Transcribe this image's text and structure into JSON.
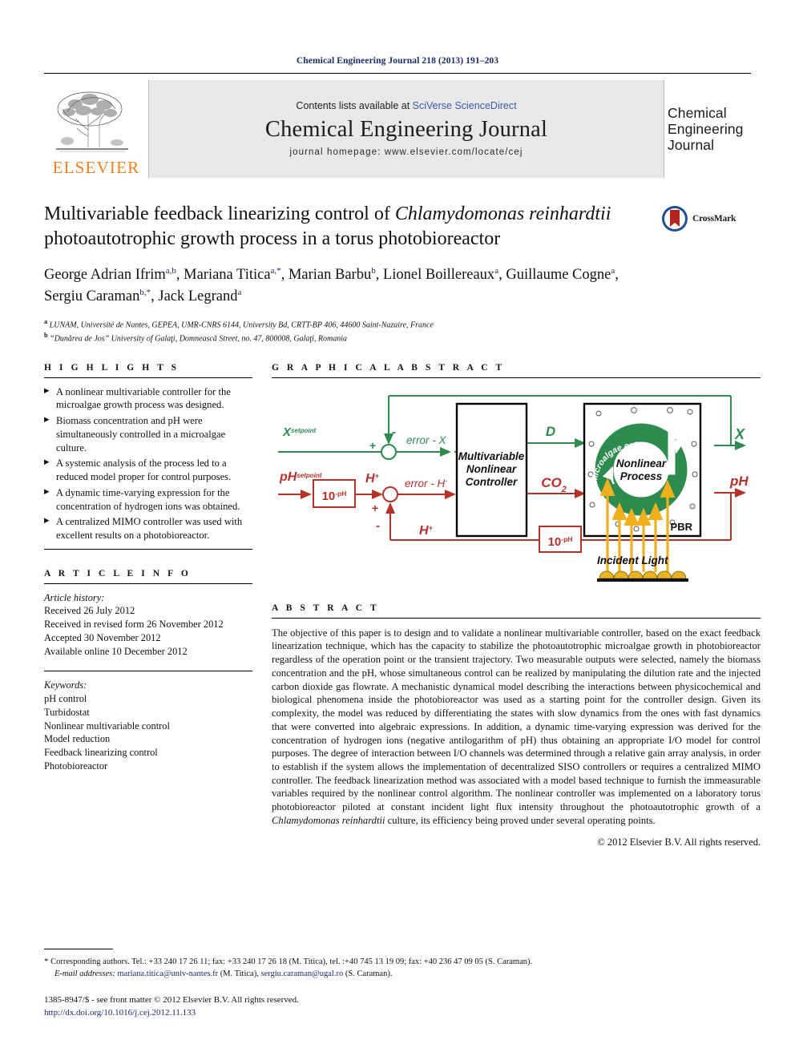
{
  "running_head": "Chemical Engineering Journal 218 (2013) 191–203",
  "masthead": {
    "contents_prefix": "Contents lists available at ",
    "contents_link": "SciVerse ScienceDirect",
    "journal_title": "Chemical Engineering Journal",
    "homepage": "journal homepage: www.elsevier.com/locate/cej",
    "publisher_word": "ELSEVIER",
    "cover_line1": "Chemical",
    "cover_line2": "Engineering",
    "cover_line3": "Journal",
    "publisher_logo_icon": "elsevier-tree-icon"
  },
  "article": {
    "title_part1": "Multivariable feedback linearizing control of ",
    "title_italic": "Chlamydomonas reinhardtii",
    "title_part2": " photoautotrophic growth process in a torus photobioreactor",
    "crossmark_label": "CrossMark",
    "crossmark_icon": "crossmark-badge-icon",
    "authors_html": "George Adrian Ifrim a,b, Mariana Titica a,*, Marian Barbu b, Lionel Boillereaux a, Guillaume Cogne a, Sergiu Caraman b,*, Jack Legrand a",
    "affiliation_a": "LUNAM, Université de Nantes, GEPEA, UMR-CNRS 6144, University Bd, CRTT-BP 406, 44600 Saint-Nazaire, France",
    "affiliation_b": "“Dunărea de Jos” University of Galaţi, Domnească Street, no. 47, 800008, Galaţi, Romania"
  },
  "highlights": {
    "heading": "H I G H L I G H T S",
    "items": [
      "A nonlinear multivariable controller for the microalgae growth process was designed.",
      "Biomass concentration and pH were simultaneously controlled in a microalgae culture.",
      "A systemic analysis of the process led to a reduced model proper for control purposes.",
      "A dynamic time-varying expression for the concentration of hydrogen ions was obtained.",
      "A centralized MIMO controller was used with excellent results on a photobioreactor."
    ]
  },
  "article_info": {
    "heading": "A R T I C L E   I N F O",
    "history_label": "Article history:",
    "history": [
      "Received 26 July 2012",
      "Received in revised form 26 November 2012",
      "Accepted 30 November 2012",
      "Available online 10 December 2012"
    ],
    "keywords_label": "Keywords:",
    "keywords": [
      "pH control",
      "Turbidostat",
      "Nonlinear multivariable control",
      "Model reduction",
      "Feedback linearizing control",
      "Photobioreactor"
    ]
  },
  "graphical_abstract": {
    "heading": "G R A P H I C A L   A B S T R A C T",
    "colors": {
      "green": "#2e8b4f",
      "red": "#b4322b",
      "gold": "#f0b01e",
      "black": "#000000"
    },
    "labels": {
      "x_setpoint_main": "X",
      "x_setpoint_sup": "setpoint",
      "ph_setpoint_main": "pH",
      "ph_setpoint_sup": "setpoint",
      "converter_in": "10",
      "converter_in_sup": "-pH",
      "h_plus_in": "H",
      "h_plus_sup": "+",
      "error_x": "error - X",
      "error_h": "error - H",
      "error_h_sup": "-",
      "controller_line1": "Multivariable",
      "controller_line2": "Nonlinear",
      "controller_line3": "Controller",
      "out_d": "D",
      "out_co2": "CO",
      "out_co2_sub": "2",
      "process_line1": "Nonlinear",
      "process_line2": "Process",
      "culture_ring": "Microalgae culture",
      "pbr": "PBR",
      "incident_light": "Incident Light",
      "feedback_converter": "10",
      "feedback_converter_sup": "-pH",
      "feedback_h": "H",
      "feedback_h_sup": "+",
      "output_x": "X",
      "output_ph": "pH",
      "plus": "+",
      "minus": "-"
    }
  },
  "abstract": {
    "heading": "A B S T R A C T",
    "p_before_italic": "The objective of this paper is to design and to validate a nonlinear multivariable controller, based on the exact feedback linearization technique, which has the capacity to stabilize the photoautotrophic microalgae growth in photobioreactor regardless of the operation point or the transient trajectory. Two measurable outputs were selected, namely the biomass concentration and the pH, whose simultaneous control can be realized by manipulating the dilution rate and the injected carbon dioxide gas flowrate. A mechanistic dynamical model describing the interactions between physicochemical and biological phenomena inside the photobioreactor was used as a starting point for the controller design. Given its complexity, the model was reduced by differentiating the states with slow dynamics from the ones with fast dynamics that were converted into algebraic expressions. In addition, a dynamic time-varying expression was derived for the concentration of hydrogen ions (negative antilogarithm of pH) thus obtaining an appropriate I/O model for control purposes. The degree of interaction between I/O channels was determined through a relative gain array analysis, in order to establish if the system allows the implementation of decentralized SISO controllers or requires a centralized MIMO controller. The feedback linearization method was associated with a model based technique to furnish the immeasurable variables required by the nonlinear control algorithm. The nonlinear controller was implemented on a laboratory torus photobioreactor piloted at constant incident light flux intensity throughout the photoautotrophic growth of a ",
    "italic_species": "Chlamydomonas reinhardtii",
    "p_after_italic": " culture, its efficiency being proved under several operating points.",
    "copyright": "© 2012 Elsevier B.V. All rights reserved."
  },
  "footer": {
    "corresponding_star": "*",
    "corresponding_text": "Corresponding authors. Tel.: +33 240 17 26 11; fax: +33 240 17 26 18 (M. Titica), tel. :+40 745 13 19 09; fax: +40 236 47 09 05 (S. Caraman).",
    "email_label": "E-mail addresses:",
    "email_1": "mariana.titica@univ-nantes.fr",
    "email_1_who": " (M. Titica), ",
    "email_2": "sergiu.caraman@ugal.ro",
    "email_2_who": " (S. Caraman).",
    "issn_line": "1385-8947/$ - see front matter © 2012 Elsevier B.V. All rights reserved.",
    "doi_line": "http://dx.doi.org/10.1016/j.cej.2012.11.133"
  }
}
